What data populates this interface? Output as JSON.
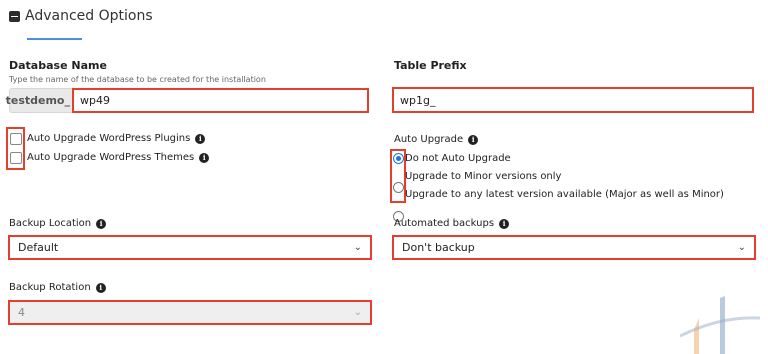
{
  "section": {
    "title": "Advanced Options"
  },
  "database": {
    "label": "Database Name",
    "hint": "Type the name of the database to be created for the installation",
    "prefix": "testdemo_",
    "value": "wp49"
  },
  "table_prefix": {
    "label": "Table Prefix",
    "value": "wp1g_"
  },
  "auto_upgrade_plugins": {
    "label": "Auto Upgrade WordPress Plugins",
    "checked": false
  },
  "auto_upgrade_themes": {
    "label": "Auto Upgrade WordPress Themes",
    "checked": false
  },
  "auto_upgrade": {
    "label": "Auto Upgrade",
    "options": [
      {
        "label": "Do not Auto Upgrade",
        "selected": true
      },
      {
        "label": "Upgrade to Minor versions only",
        "selected": false
      },
      {
        "label": "Upgrade to any latest version available (Major as well as Minor)",
        "selected": false
      }
    ]
  },
  "backup_location": {
    "label": "Backup Location",
    "value": "Default"
  },
  "automated_backups": {
    "label": "Automated backups",
    "value": "Don't backup"
  },
  "backup_rotation": {
    "label": "Backup Rotation",
    "value": "4"
  },
  "icons": {
    "info": "info-icon",
    "section": "minus-square-icon",
    "dropdown": "chevron-down-icon"
  },
  "colors": {
    "highlight": "#e53e2c",
    "accent": "#4a90e2",
    "radio": "#1a73e8"
  }
}
